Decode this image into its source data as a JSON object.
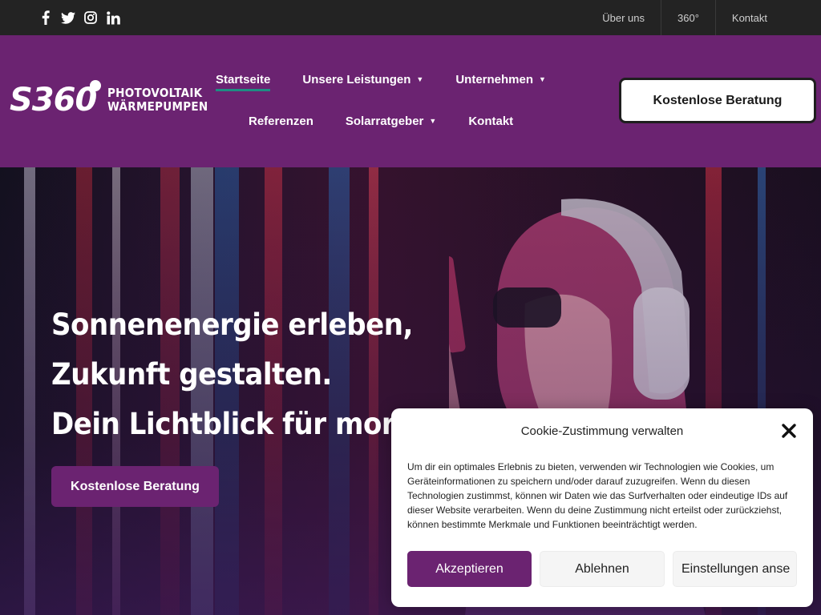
{
  "topbar": {
    "social": [
      "facebook-icon",
      "twitter-icon",
      "instagram-icon",
      "linkedin-icon"
    ],
    "links": [
      "Über uns",
      "360°",
      "Kontakt"
    ]
  },
  "header": {
    "logo_mark": "S360",
    "logo_line1": "PHOTOVOLTAIK",
    "logo_line2": "WÄRMEPUMPEN",
    "nav_row1": [
      {
        "label": "Startseite",
        "dropdown": false,
        "active": true
      },
      {
        "label": "Unsere Leistungen",
        "dropdown": true
      },
      {
        "label": "Unternehmen",
        "dropdown": true
      }
    ],
    "nav_row2": [
      {
        "label": "Referenzen",
        "dropdown": false
      },
      {
        "label": "Solarratgeber",
        "dropdown": true
      },
      {
        "label": "Kontakt",
        "dropdown": false
      }
    ],
    "cta": "Kostenlose Beratung"
  },
  "hero": {
    "line1": "Sonnenenergie erleben,",
    "line2": "Zukunft gestalten.",
    "line3": "Dein Lichtblick für mor",
    "cta": "Kostenlose Beratung"
  },
  "cookie": {
    "title": "Cookie-Zustimmung verwalten",
    "text": "Um dir ein optimales Erlebnis zu bieten, verwenden wir Technologien wie Cookies, um Geräteinformationen zu speichern und/oder darauf zuzugreifen. Wenn du diesen Technologien zustimmst, können wir Daten wie das Surfverhalten oder eindeutige IDs auf dieser Website verarbeiten. Wenn du deine Zustimmung nicht erteilst oder zurückziehst, können bestimmte Merkmale und Funktionen beeinträchtigt werden.",
    "accept": "Akzeptieren",
    "deny": "Ablehnen",
    "prefs": "Einstellungen anse"
  },
  "colors": {
    "brand_purple": "#6b2371",
    "active_underline": "#1e8d83",
    "topbar_bg": "#232323"
  }
}
